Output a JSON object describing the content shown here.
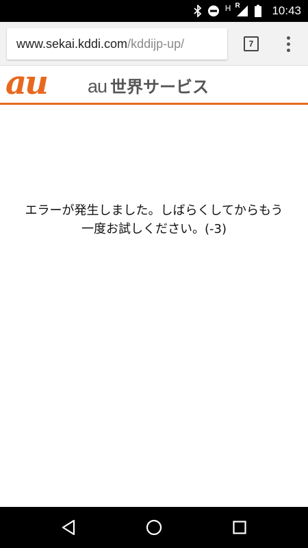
{
  "status_bar": {
    "time": "10:43",
    "signal_label": "H",
    "roaming_label": "R",
    "icons": [
      "bluetooth-icon",
      "do-not-disturb-icon",
      "signal-icon",
      "battery-icon"
    ]
  },
  "browser": {
    "url_host": "www.sekai.kddi.com",
    "url_path": "/kddijp-up/",
    "tab_count": "7",
    "menu_icon": "overflow-menu-icon"
  },
  "site_header": {
    "logo_text": "au",
    "service_prefix": "au",
    "service_name": "世界サービス",
    "accent_color": "#e8691e"
  },
  "content": {
    "error_line1": "エラーが発生しました。しばらくしてからもう",
    "error_line2": "一度お試しください。(-3)"
  },
  "nav_bar": {
    "icons": [
      "back-icon",
      "home-icon",
      "recents-icon"
    ]
  }
}
